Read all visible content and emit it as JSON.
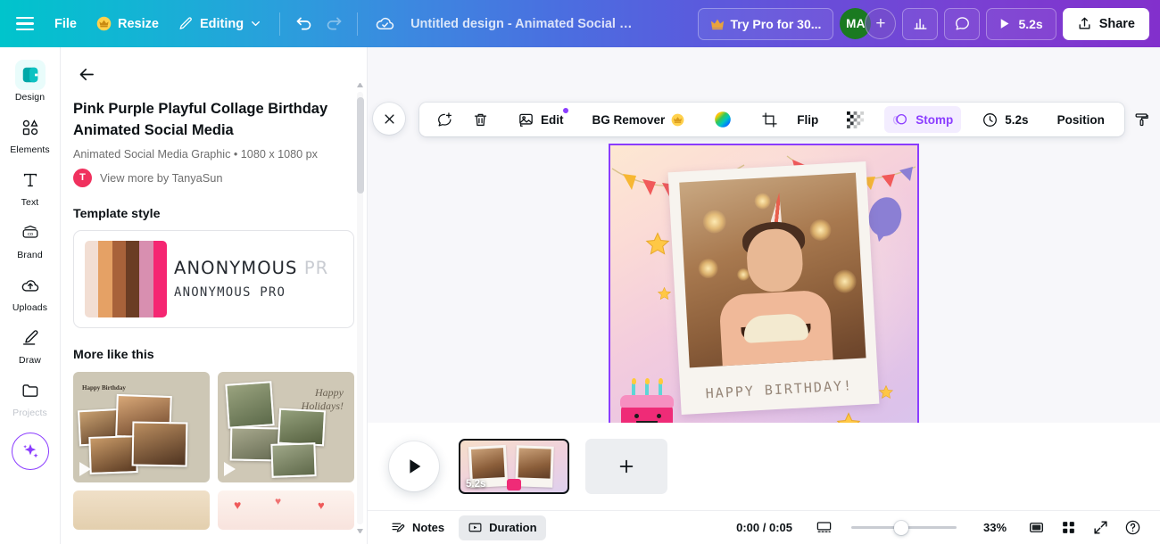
{
  "topbar": {
    "menu_icon": "hamburger-icon",
    "file_label": "File",
    "resize_label": "Resize",
    "resize_icon": "crown-icon",
    "editing_label": "Editing",
    "editing_icon": "pencil-icon",
    "editing_caret": "chevron-down-icon",
    "undo_icon": "undo-icon",
    "redo_icon": "redo-icon",
    "cloud_icon": "cloud-saved-icon",
    "doc_title": "Untitled design - Animated Social Medi...",
    "try_pro_label": "Try Pro for 30...",
    "try_pro_icon": "crown-icon",
    "avatar_initials": "MA",
    "avatar_color": "#1a7a20",
    "add_people_label": "+",
    "insights_icon": "bar-chart-icon",
    "comment_icon": "comment-icon",
    "play_icon": "play-icon",
    "play_duration": "5.2s",
    "share_label": "Share",
    "share_icon": "share-upload-icon",
    "gradient_start": "#00c4cc",
    "gradient_end": "#8230cc"
  },
  "sidebar": {
    "items": [
      {
        "label": "Design",
        "icon": "design-icon",
        "active": true,
        "dim": false
      },
      {
        "label": "Elements",
        "icon": "elements-icon",
        "active": false,
        "dim": false
      },
      {
        "label": "Text",
        "icon": "text-icon",
        "active": false,
        "dim": false
      },
      {
        "label": "Brand",
        "icon": "brand-icon",
        "active": false,
        "dim": false
      },
      {
        "label": "Uploads",
        "icon": "uploads-icon",
        "active": false,
        "dim": false
      },
      {
        "label": "Draw",
        "icon": "draw-icon",
        "active": false,
        "dim": false
      },
      {
        "label": "Projects",
        "icon": "projects-icon",
        "active": false,
        "dim": true
      }
    ],
    "magic_icon": "magic-sparkle-icon"
  },
  "panel": {
    "back_icon": "back-arrow-icon",
    "template_title": "Pink Purple Playful Collage Birthday Animated Social Media",
    "template_meta": "Animated Social Media Graphic • 1080 x 1080 px",
    "author_initial": "T",
    "author_link": "View more by TanyaSun",
    "template_style_heading": "Template style",
    "style_swatches": [
      "#f2ded3",
      "#e5a165",
      "#a8623a",
      "#6b3d24",
      "#d88fb0",
      "#f52672"
    ],
    "font_primary": "ANONYMOUS",
    "font_primary_ghost": "PR",
    "font_secondary": "ANONYMOUS PRO",
    "more_like_this_heading": "More like this",
    "more_cards": [
      {
        "name": "happy-birthday-collage",
        "label": "Happy Birthday",
        "has_play": true
      },
      {
        "name": "happy-holidays-collage",
        "label": "Happy\nHolidays!",
        "has_play": true
      },
      {
        "name": "beige-template",
        "label": "",
        "has_play": false
      },
      {
        "name": "hearts-template",
        "label": "",
        "has_play": false
      }
    ]
  },
  "toolbar": {
    "close_icon": "close-icon",
    "animate_icon": "animate-icon",
    "delete_icon": "trash-icon",
    "edit_label": "Edit",
    "edit_icon": "edit-image-icon",
    "bg_remover_label": "BG Remover",
    "bg_remover_icon": "crown-icon",
    "color_wheel_icon": "color-wheel-icon",
    "crop_icon": "crop-icon",
    "flip_label": "Flip",
    "transparency_icon": "transparency-icon",
    "animation_label": "Stomp",
    "animation_icon": "animation-circle-icon",
    "duration_label": "5.2s",
    "duration_icon": "clock-icon",
    "position_label": "Position",
    "more_icon": "paint-roller-icon"
  },
  "canvas": {
    "design_text": "HAPPY BIRTHDAY!",
    "selection_color": "#8b3dff"
  },
  "timeline": {
    "play_icon": "play-icon",
    "scene_duration": "5.2s",
    "add_page_icon": "plus-icon",
    "heart_icon": "heart-marker-icon"
  },
  "statusbar": {
    "notes_label": "Notes",
    "notes_icon": "notes-icon",
    "duration_label": "Duration",
    "duration_icon": "duration-icon",
    "time_display": "0:00 / 0:05",
    "timeline_toggle_icon": "timeline-view-icon",
    "zoom_percent": "33%",
    "zoom_value": 33,
    "fit_icon": "fit-screen-icon",
    "grid_icon": "grid-view-icon",
    "fullscreen_icon": "fullscreen-icon",
    "help_icon": "help-icon"
  }
}
